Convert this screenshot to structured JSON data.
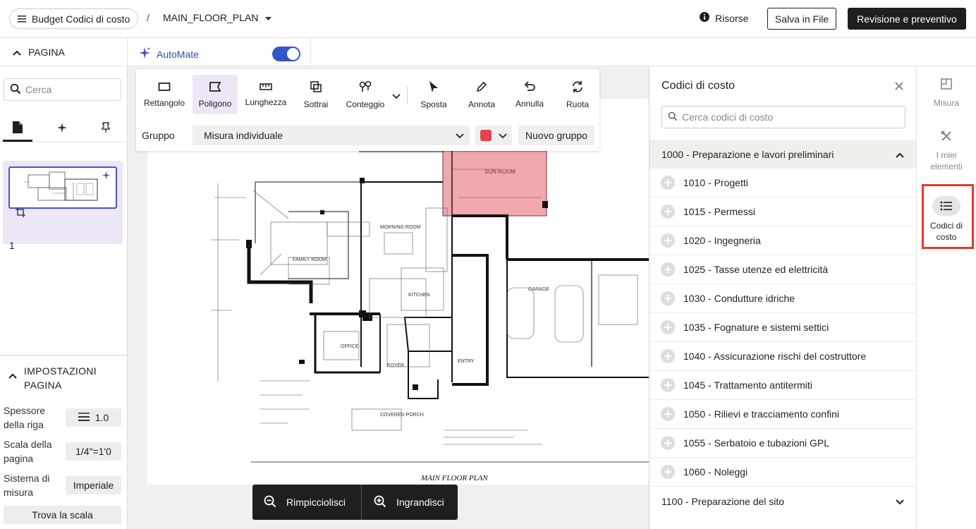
{
  "header": {
    "menu_label": "Budget Codici di costo",
    "separator": "/",
    "plan_name": "MAIN_FLOOR_PLAN",
    "resources_label": "Risorse",
    "save_label": "Salva in File",
    "review_label": "Revisione e preventivo"
  },
  "subheader": {
    "page_label": "PAGINA",
    "automate_label": "AutoMate",
    "automate_on": true
  },
  "left": {
    "search_placeholder": "Cerca",
    "page_number": "1",
    "settings_title_1": "IMPOSTAZIONI",
    "settings_title_2": "PAGINA",
    "line_thickness_label_1": "Spessore",
    "line_thickness_label_2": "della riga",
    "line_thickness_value": "1.0",
    "scale_label_1": "Scala della",
    "scale_label_2": "pagina",
    "scale_value": "1/4\"=1'0",
    "system_label_1": "Sistema di",
    "system_label_2": "misura",
    "system_value": "Imperiale",
    "find_scale_label": "Trova la scala"
  },
  "toolbar": {
    "tools": [
      {
        "label": "Rettangolo",
        "icon": "rectangle-icon"
      },
      {
        "label": "Poligono",
        "icon": "polygon-icon",
        "active": true
      },
      {
        "label": "Lunghezza",
        "icon": "ruler-icon"
      },
      {
        "label": "Sottrai",
        "icon": "subtract-icon"
      },
      {
        "label": "Conteggio",
        "icon": "count-icon"
      },
      {
        "label": "Sposta",
        "icon": "cursor-icon"
      },
      {
        "label": "Annota",
        "icon": "pen-icon"
      },
      {
        "label": "Annulla",
        "icon": "undo-icon"
      },
      {
        "label": "Ruota",
        "icon": "rotate-icon"
      }
    ],
    "group_label": "Gruppo",
    "group_value": "Misura individuale",
    "color": "#e0434e",
    "new_group_label": "Nuovo gruppo"
  },
  "drawing": {
    "plan_title": "MAIN FLOOR PLAN",
    "rooms": [
      "SUN ROOM",
      "FAMILY ROOM",
      "MORNING ROOM",
      "KITCHEN",
      "GARAGE",
      "OFFICE",
      "FOYER",
      "ENTRY",
      "COVERED PORCH"
    ],
    "highlight_color": "#f0a3aa"
  },
  "zoom": {
    "out_label": "Rimpicciolisci",
    "in_label": "Ingrandisci"
  },
  "cost_codes": {
    "title": "Codici di costo",
    "search_placeholder": "Cerca codici di costo",
    "open_category": "1000 - Preparazione e lavori preliminari",
    "items": [
      "1010 - Progetti",
      "1015 - Permessi",
      "1020 - Ingegneria",
      "1025 - Tasse utenze ed elettricità",
      "1030 - Condutture idriche",
      "1035 - Fognature e sistemi settici",
      "1040 - Assicurazione rischi del costruttore",
      "1045 - Trattamento antitermiti",
      "1050 - Rilievi e tracciamento confini",
      "1055 - Serbatoio e tubazioni GPL",
      "1060 - Noleggi"
    ],
    "closed_category": "1100 - Preparazione del sito"
  },
  "rail": {
    "measure_label": "Misura",
    "my_items_label_1": "I miei",
    "my_items_label_2": "elementi",
    "cost_codes_label_1": "Codici di",
    "cost_codes_label_2": "costo"
  },
  "colors": {
    "accent": "#3355c9",
    "highlight_box": "#e8372a",
    "dark_button": "#1f1f1f",
    "selected_bg": "#ece6f7"
  }
}
